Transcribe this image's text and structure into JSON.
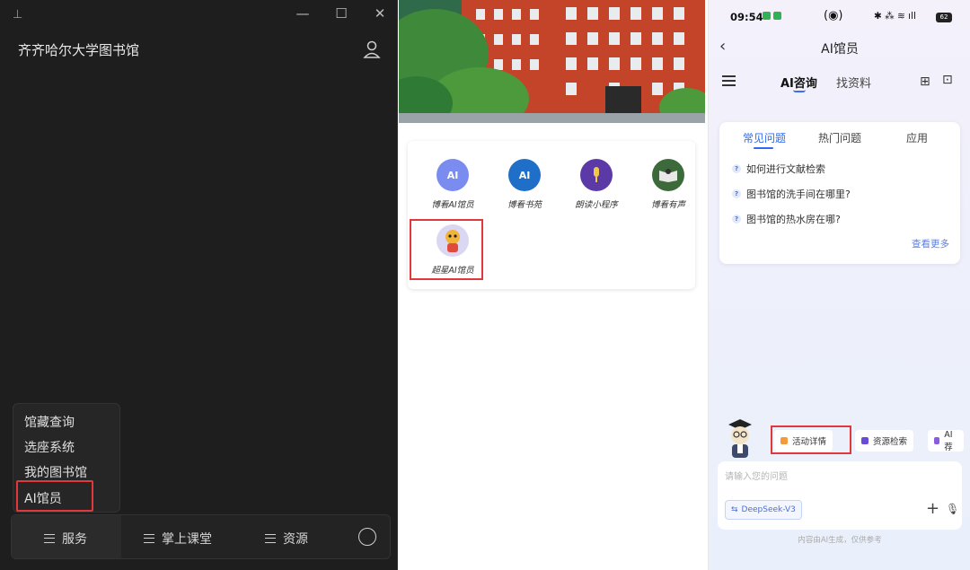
{
  "desktop": {
    "title": "齐齐哈尔大学图书馆",
    "window_controls": {
      "minimize": "—",
      "maximize": "☐",
      "close": "✕"
    },
    "pin_glyph": "⊥",
    "menu": [
      "馆藏查询",
      "选座系统",
      "我的图书馆",
      "AI馆员"
    ],
    "bottom_nav": [
      "服务",
      "掌上课堂",
      "资源"
    ],
    "highlight_color": "#e0393c"
  },
  "mobile_apps": {
    "apps": [
      {
        "label": "博看AI馆员",
        "icon_text": "AI"
      },
      {
        "label": "博看书苑",
        "icon_text": "AI"
      },
      {
        "label": "朗读小程序",
        "icon_text": ""
      },
      {
        "label": "博看有声",
        "icon_text": ""
      },
      {
        "label": "超星AI馆员",
        "icon_text": ""
      }
    ]
  },
  "ai_page": {
    "status": {
      "time": "09:54",
      "center": "(◉)",
      "right": "✱ ⁂ ≋ ıll",
      "battery": "62"
    },
    "back": "‹",
    "title": "AI馆员",
    "top_tabs": [
      "AI咨询",
      "找资料"
    ],
    "grid_icon": "⊞",
    "chat_icon": "⊡",
    "question_tabs": [
      "常见问题",
      "热门问题",
      "应用"
    ],
    "questions": [
      "如何进行文献检索",
      "图书馆的洗手间在哪里?",
      "图书馆的热水房在哪?"
    ],
    "question_mark": "?",
    "more": "查看更多",
    "chips": [
      "活动详情",
      "资源检索",
      "AI荐"
    ],
    "input_placeholder": "请输入您的问题",
    "model": "DeepSeek-V3",
    "model_icon": "⇆",
    "plus": "+",
    "mic": "🎙",
    "disclaimer": "内容由AI生成，仅供参考",
    "accent": "#2f6bf0"
  }
}
